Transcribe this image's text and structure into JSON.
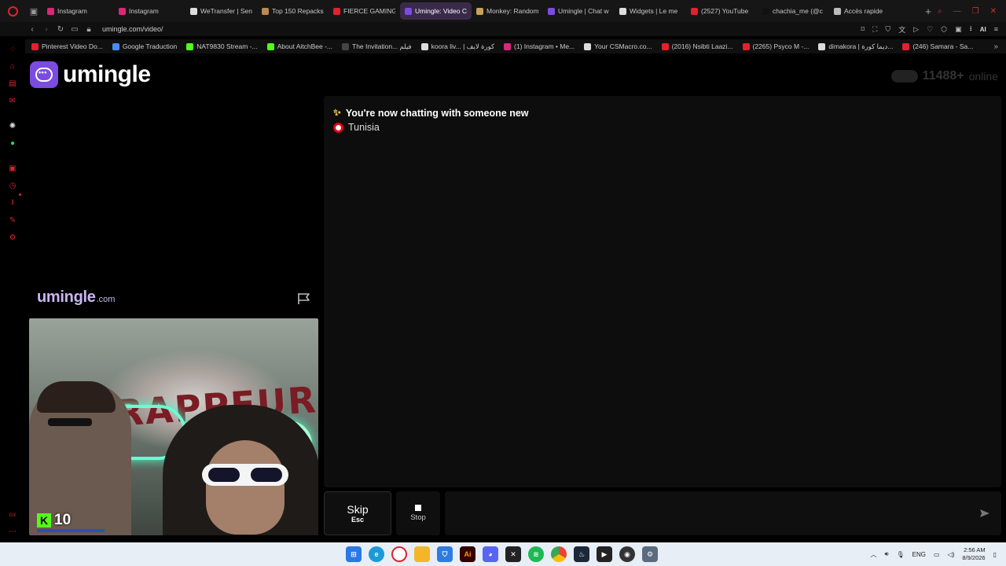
{
  "browser": {
    "tabs": [
      {
        "label": "Instagram",
        "color": "#d6297a",
        "active": false
      },
      {
        "label": "Instagram",
        "color": "#d6297a",
        "active": false
      },
      {
        "label": "WeTransfer | Sen",
        "color": "#dddddd",
        "active": false
      },
      {
        "label": "Top 150 Repacks",
        "color": "#b98a52",
        "active": false
      },
      {
        "label": "FIERCE GAMING",
        "color": "#e0222e",
        "active": false
      },
      {
        "label": "Umingle: Video Chat w",
        "color": "#7b4ce0",
        "active": true
      },
      {
        "label": "Monkey: Random",
        "color": "#c8a25a",
        "active": false
      },
      {
        "label": "Umingle | Chat w",
        "color": "#7b4ce0",
        "active": false
      },
      {
        "label": "Widgets | Le me",
        "color": "#dddddd",
        "active": false
      },
      {
        "label": "(2527) YouTube",
        "color": "#e0222e",
        "active": false
      },
      {
        "label": "chachia_me (@c",
        "color": "#111111",
        "active": false
      },
      {
        "label": "Accès rapide",
        "color": "#bbbbbb",
        "active": false
      }
    ],
    "url": "umingle.com/video/",
    "ai_label": "AI",
    "bookmarks": [
      {
        "label": "Pinterest Video Do...",
        "color": "#e0222e"
      },
      {
        "label": "Google Traduction",
        "color": "#4a8af4"
      },
      {
        "label": "NAT9830 Stream -...",
        "color": "#53fc18"
      },
      {
        "label": "About AitchBee -...",
        "color": "#53fc18"
      },
      {
        "label": "The Invitation... فيلم",
        "color": "#444444"
      },
      {
        "label": "koora liv... | كورة لايف",
        "color": "#dddddd"
      },
      {
        "label": "(1) Instagram • Me...",
        "color": "#d6297a"
      },
      {
        "label": "Your CSMacro.co...",
        "color": "#dddddd"
      },
      {
        "label": "(2016) Nsibti Laazi...",
        "color": "#e0222e"
      },
      {
        "label": "(2265) Psyco M -...",
        "color": "#e0222e"
      },
      {
        "label": "dimakora | ديما كورة...",
        "color": "#dddddd"
      },
      {
        "label": "(246) Samara - Sa...",
        "color": "#e0222e"
      }
    ]
  },
  "site": {
    "logo_text": "umingle",
    "online_count": "11488+",
    "online_label": "online",
    "watermark_main": "umingle",
    "watermark_sub": ".com",
    "chat": {
      "status_message": "You're now chatting with someone new",
      "partner_country": "Tunisia"
    },
    "controls": {
      "skip_label": "Skip",
      "skip_key": "Esc",
      "stop_label": "Stop",
      "message_placeholder": ""
    },
    "self_video": {
      "overlay_count": "10",
      "art_text": "RAPPEUR"
    }
  },
  "taskbar": {
    "language": "ENG",
    "time": "2:56 AM",
    "date": "8/9/2026"
  },
  "colors": {
    "brand_purple": "#7b4ce0",
    "watermark_lavender": "#c9b6f2",
    "opera_red": "#e0222e",
    "kick_green": "#53fc18"
  }
}
